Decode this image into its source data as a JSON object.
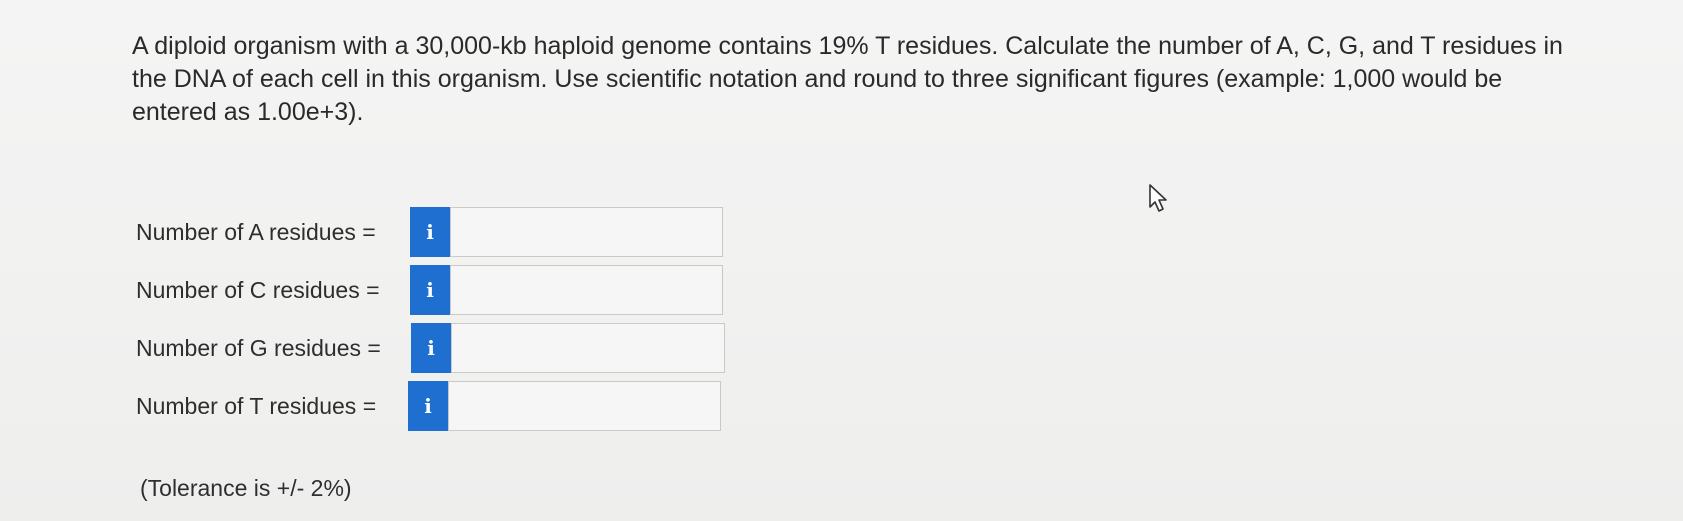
{
  "question": {
    "text": "A diploid organism with a 30,000-kb haploid genome contains 19% T residues. Calculate the number of A, C, G, and T residues in the DNA of each cell in this organism. Use scientific notation and round to three significant figures (example: 1,000 would be entered as 1.00e+3)."
  },
  "fields": [
    {
      "label": "Number of A residues =",
      "info_icon": "i",
      "value": ""
    },
    {
      "label": "Number of C residues =",
      "info_icon": "i",
      "value": ""
    },
    {
      "label": "Number of G residues =",
      "info_icon": "i",
      "value": ""
    },
    {
      "label": "Number of T residues =",
      "info_icon": "i",
      "value": ""
    }
  ],
  "tolerance": "(Tolerance is +/- 2%)",
  "colors": {
    "info_button": "#1f6fd0",
    "text": "#2a2a2a"
  }
}
